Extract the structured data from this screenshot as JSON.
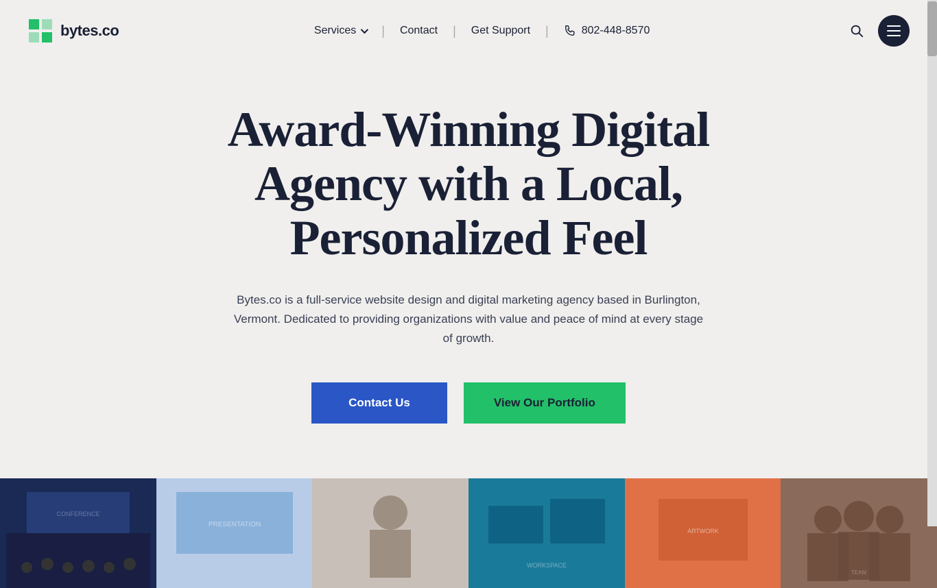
{
  "logo": {
    "text": "bytes.co",
    "icon_color_primary": "#22c068",
    "icon_color_dark": "#1a2035"
  },
  "nav": {
    "services_label": "Services",
    "contact_label": "Contact",
    "get_support_label": "Get Support",
    "phone": "802-448-8570",
    "divider": "|"
  },
  "hero": {
    "title": "Award-Winning Digital Agency with a Local, Personalized Feel",
    "subtitle": "Bytes.co is a full-service website design and digital marketing agency based in Burlington, Vermont. Dedicated to providing organizations with value and peace of mind at every stage of growth.",
    "contact_btn": "Contact Us",
    "portfolio_btn": "View Our Portfolio"
  },
  "images": [
    {
      "label": "Conference audience",
      "class": "img-1"
    },
    {
      "label": "Blue presentation",
      "class": "img-2"
    },
    {
      "label": "Person at desk",
      "class": "img-3"
    },
    {
      "label": "Tech workspace",
      "class": "img-4"
    },
    {
      "label": "Artwork display",
      "class": "img-5"
    },
    {
      "label": "Team photo",
      "class": "img-6"
    }
  ],
  "colors": {
    "accent_blue": "#2a56c6",
    "accent_green": "#22c068",
    "dark": "#1a2035",
    "bg": "#f0efed"
  }
}
